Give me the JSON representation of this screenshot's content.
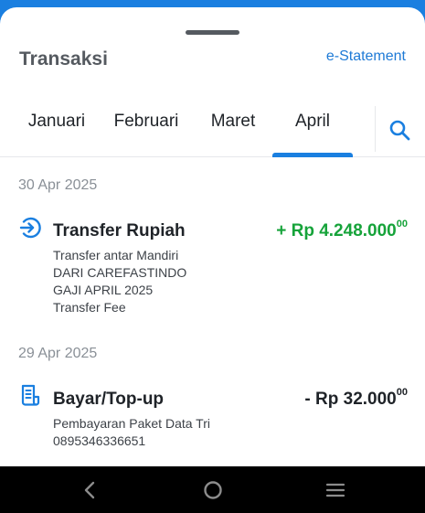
{
  "header": {
    "title": "Transaksi",
    "estatement_label": "e-Statement"
  },
  "tabs": [
    {
      "label": "Januari",
      "active": false
    },
    {
      "label": "Februari",
      "active": false
    },
    {
      "label": "Maret",
      "active": false
    },
    {
      "label": "April",
      "active": true
    }
  ],
  "colors": {
    "accent": "#1a7fe0",
    "credit": "#16a33a",
    "text": "#1f2328",
    "muted": "#8a9097"
  },
  "groups": [
    {
      "date": "30 Apr 2025",
      "transactions": [
        {
          "icon": "arrow-right-circle-icon",
          "title": "Transfer Rupiah",
          "amount": "+ Rp 4.248.000",
          "amount_cents": "00",
          "type": "credit",
          "details": [
            "Transfer antar Mandiri",
            "DARI CAREFASTINDO",
            "GAJI APRIL 2025",
            "Transfer Fee"
          ]
        }
      ]
    },
    {
      "date": "29 Apr 2025",
      "transactions": [
        {
          "icon": "receipt-icon",
          "title": "Bayar/Top-up",
          "amount": "- Rp 32.000",
          "amount_cents": "00",
          "type": "debit",
          "details": [
            "Pembayaran Paket Data Tri",
            "0895346336651"
          ]
        }
      ]
    }
  ],
  "navbar": {
    "icons": [
      "back-icon",
      "home-icon",
      "recents-icon"
    ]
  }
}
